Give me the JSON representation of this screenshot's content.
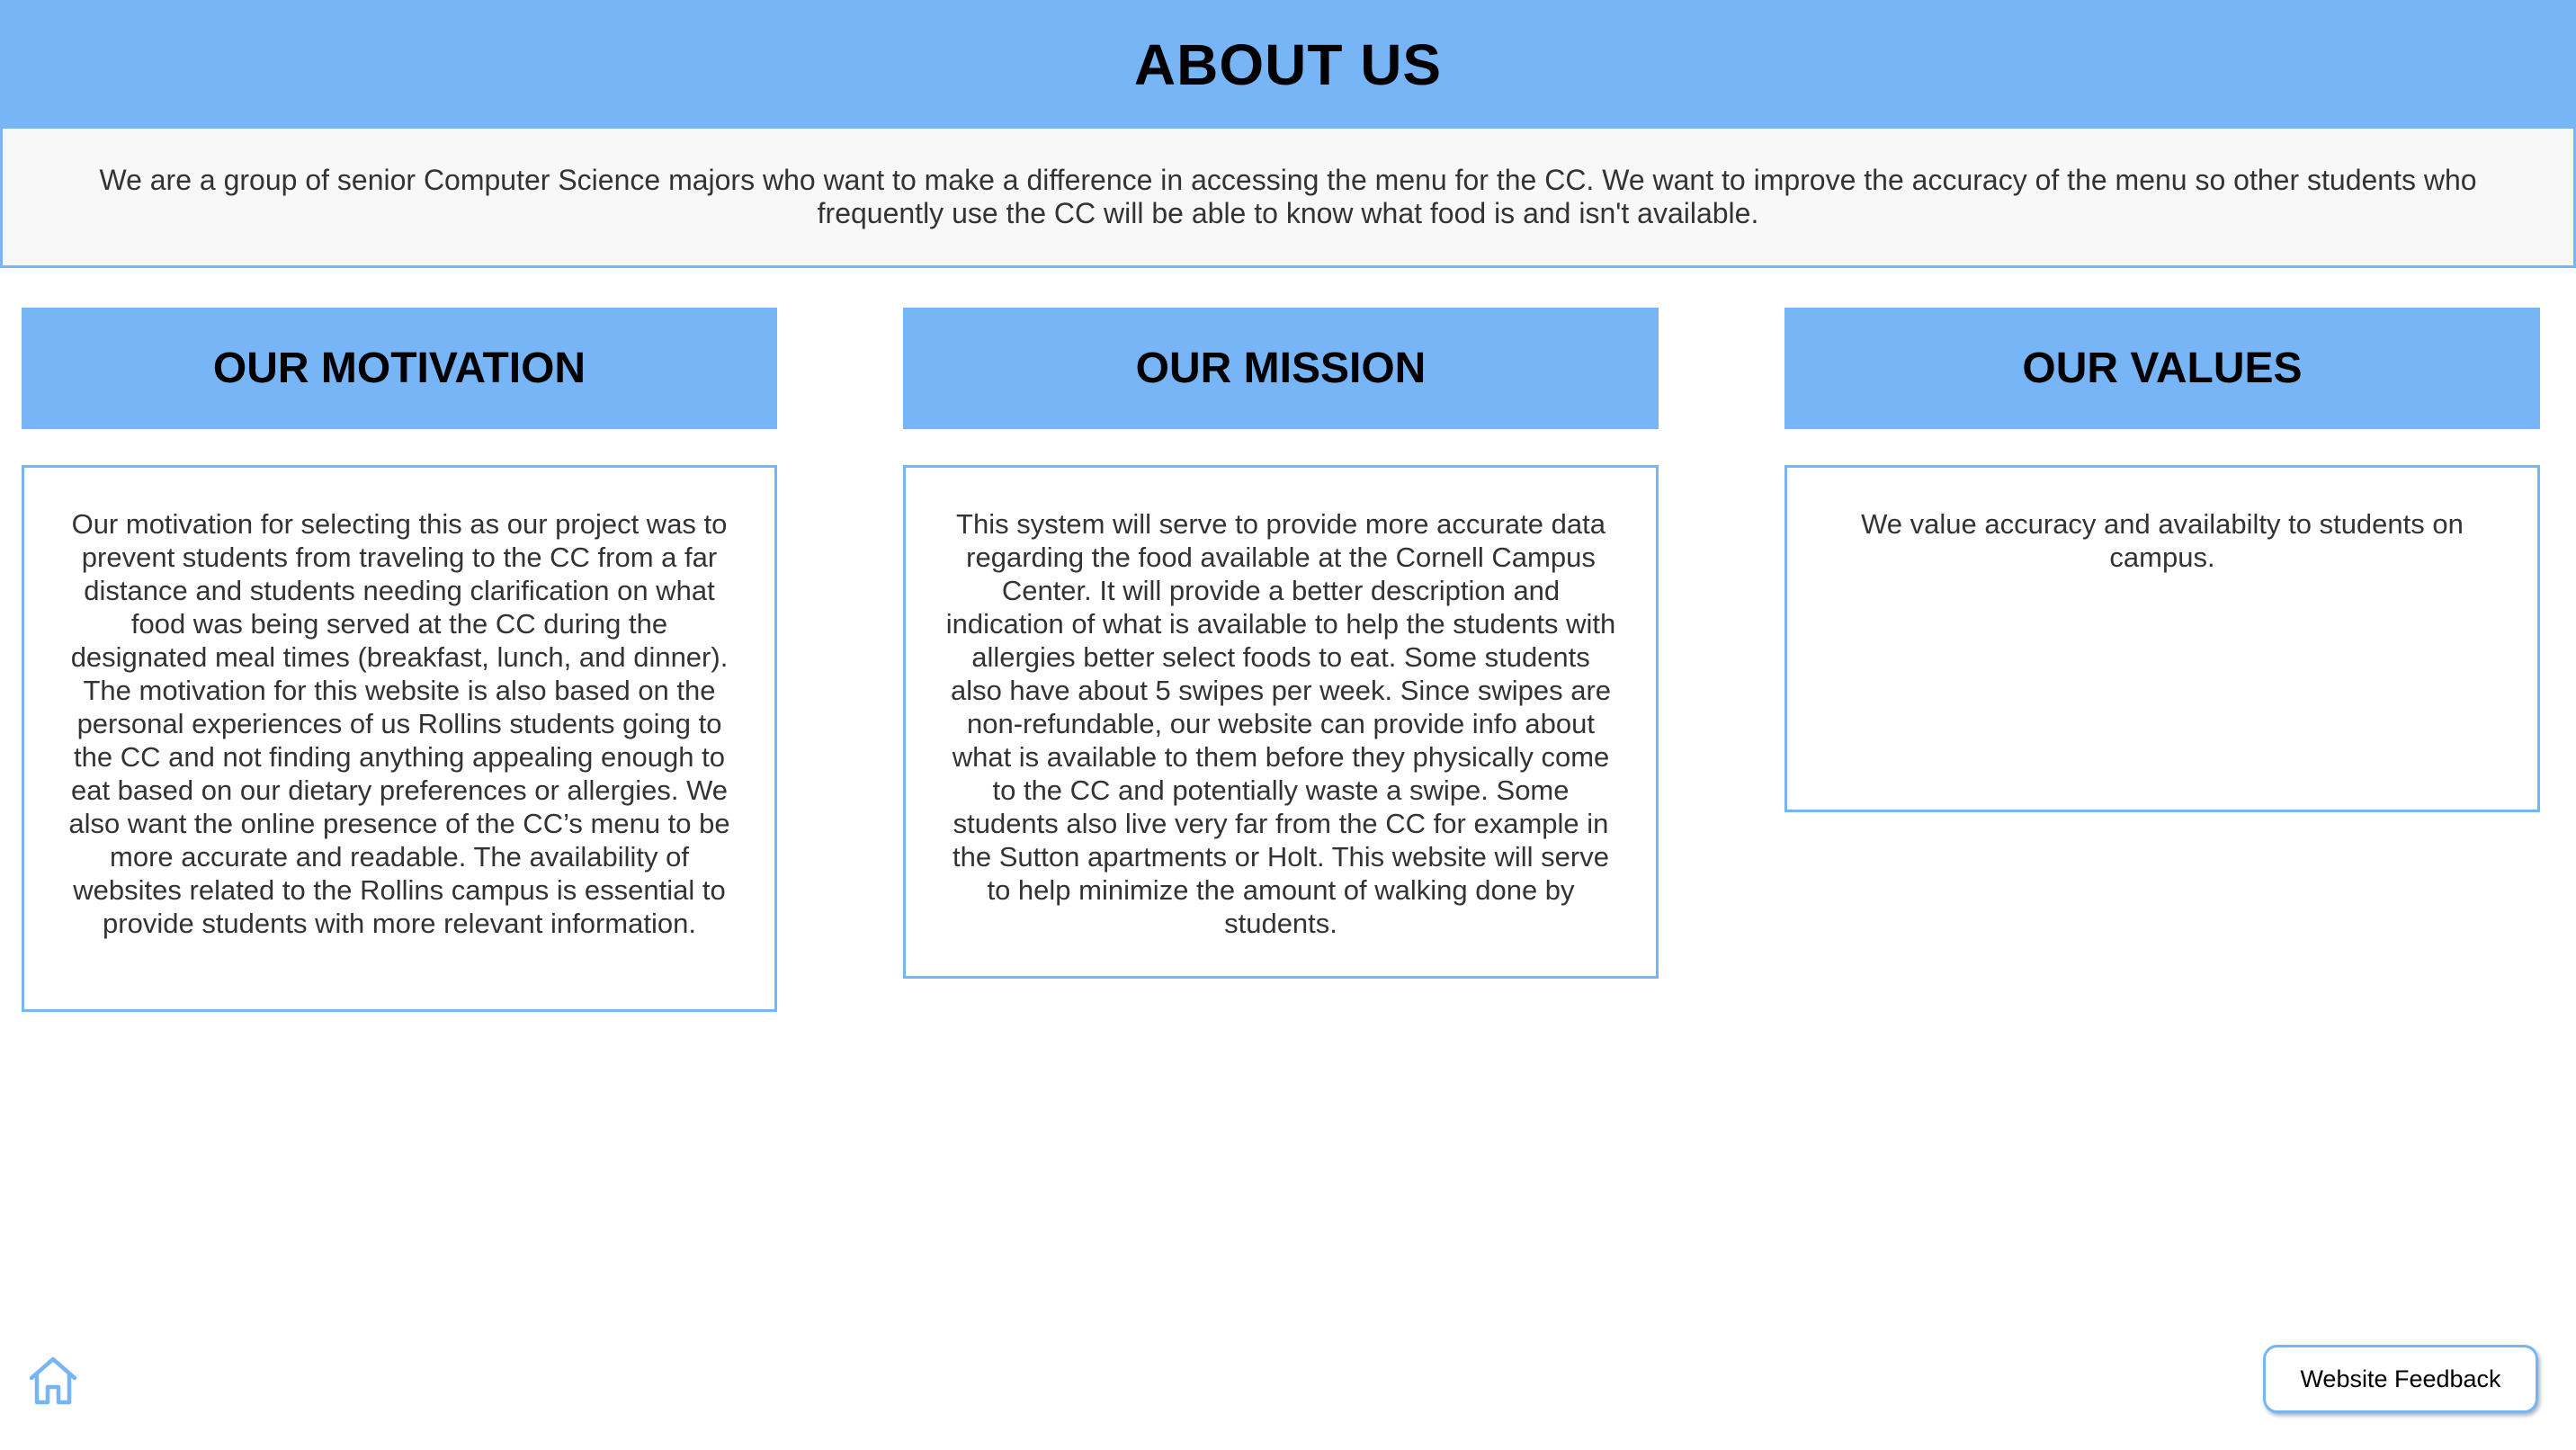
{
  "header": {
    "title": "ABOUT US"
  },
  "intro": {
    "text": "We are a group of senior Computer Science majors who want to make a difference in accessing the menu for the CC. We want to improve the accuracy of the menu so other students who frequently use the CC will be able to know what food is and isn't available."
  },
  "cards": [
    {
      "title": "OUR MOTIVATION",
      "text": "Our motivation for selecting this as our project was to prevent students from traveling to the CC from a far distance and students needing clarification on what food was being served at the CC during the designated meal times (breakfast, lunch, and dinner). The motivation for this website is also based on the personal experiences of us Rollins students going to the CC and not finding anything appealing enough to eat based on our dietary preferences or allergies. We also want the online presence of the CC’s menu to be more accurate and readable. The availability of websites related to the Rollins campus is essential to provide students with more relevant information."
    },
    {
      "title": "OUR MISSION",
      "text": "This system will serve to provide more accurate data regarding the food available at the Cornell Campus Center. It will provide a better description and indication of what is available to help the students with allergies better select foods to eat. Some students also have about 5 swipes per week. Since swipes are non-refundable, our website can provide info about what is available to them before they physically come to the CC and potentially waste a swipe. Some students also live very far from the CC for example in the Sutton apartments or Holt. This website will serve to help minimize the amount of walking done by students."
    },
    {
      "title": "OUR VALUES",
      "text": "We value accuracy and availabilty to students on campus."
    }
  ],
  "footer": {
    "home_icon": "home-icon",
    "feedback_label": "Website Feedback"
  },
  "colors": {
    "accent": "#77b5f7",
    "intro_background": "#f8f8f8",
    "text": "#333333"
  }
}
